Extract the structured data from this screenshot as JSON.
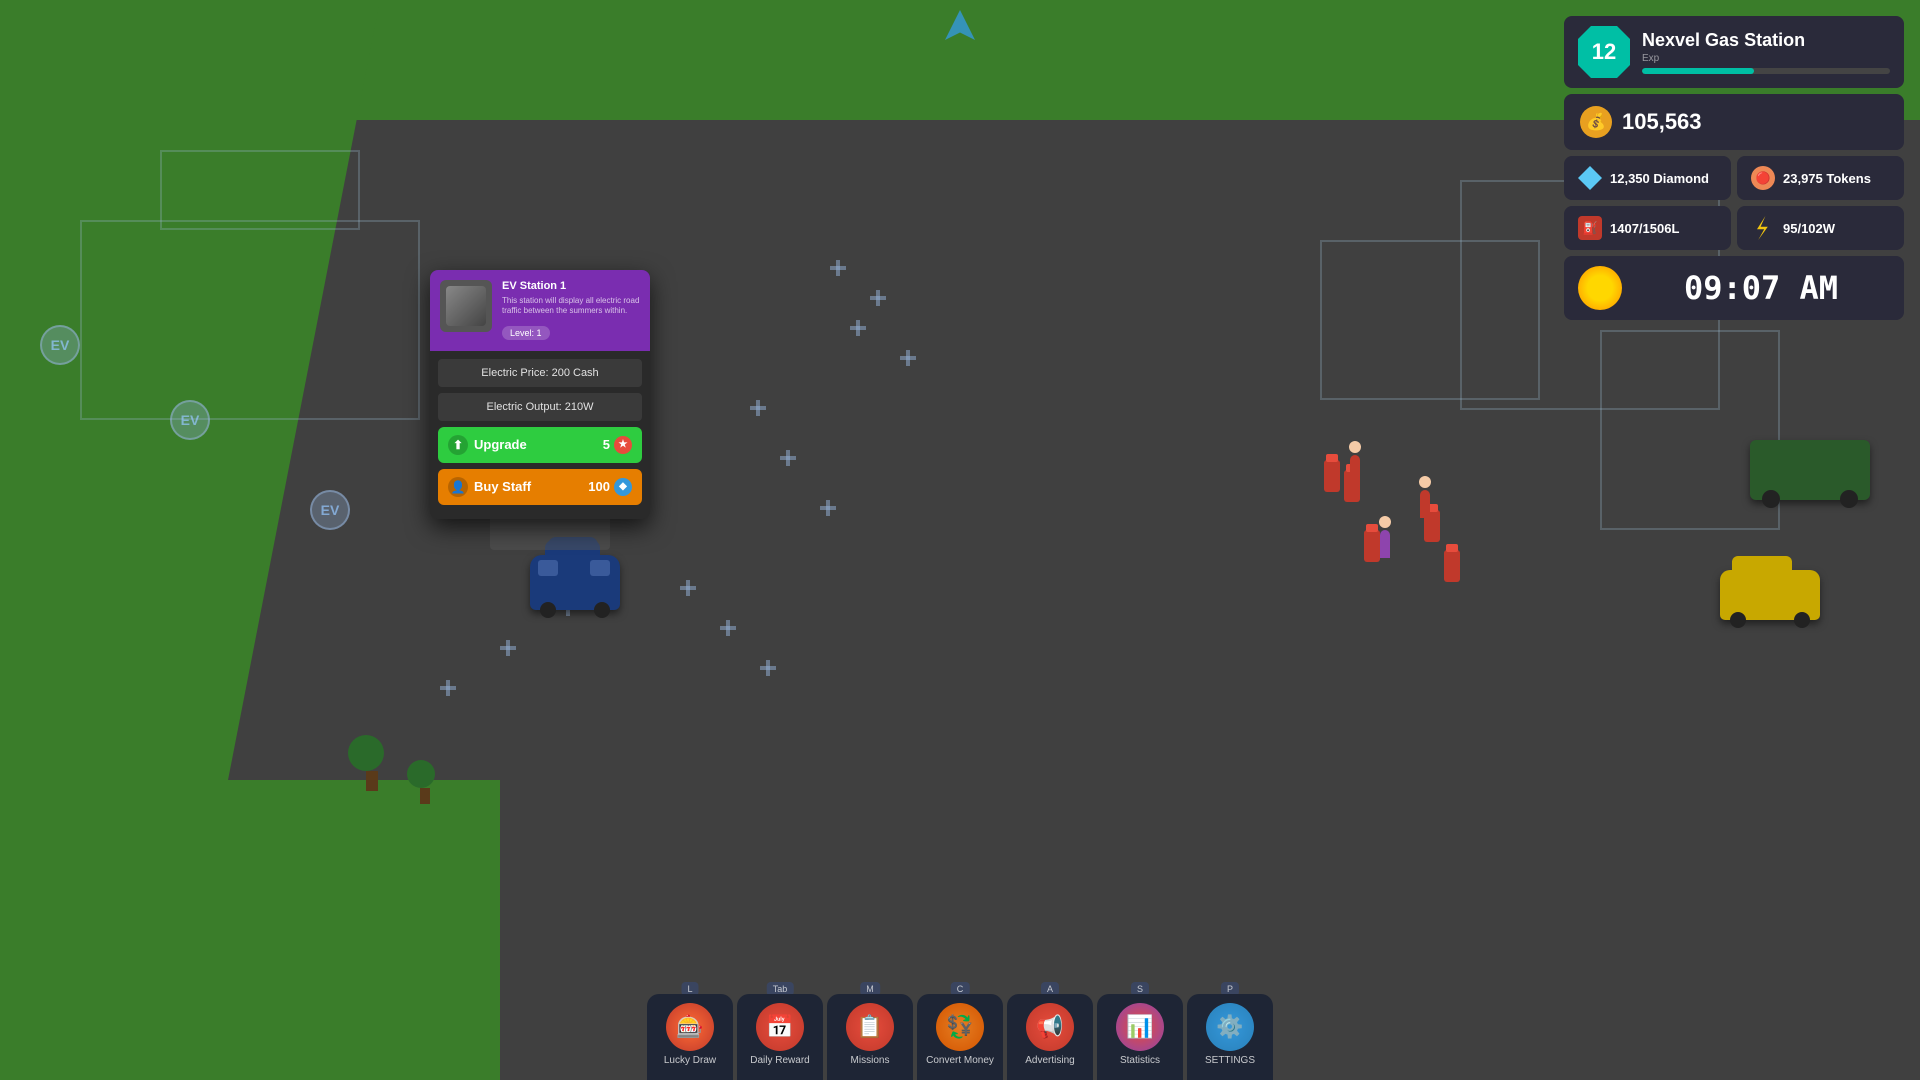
{
  "game": {
    "title": "Nexvel Gas Station"
  },
  "hud": {
    "level": "12",
    "station_name": "Nexvel Gas Station",
    "exp_label": "Exp",
    "exp_percent": 45,
    "cash": "105,563",
    "diamond": "12,350 Diamond",
    "tokens": "23,975 Tokens",
    "fuel": "1407/1506L",
    "power": "95/102W",
    "time": "09:07 AM"
  },
  "popup": {
    "title": "EV Station 1",
    "description": "This station will display all electric road traffic between the summers within.",
    "level": "Level: 1",
    "electric_price": "Electric Price: 200 Cash",
    "electric_output": "Electric Output: 210W",
    "upgrade_label": "Upgrade",
    "upgrade_cost": "5",
    "buy_staff_label": "Buy Staff",
    "buy_staff_cost": "100"
  },
  "toolbar": {
    "items": [
      {
        "id": "lucky-draw",
        "label": "Lucky Draw",
        "key": "L",
        "icon": "🎰"
      },
      {
        "id": "daily-reward",
        "label": "Daily Reward",
        "key": "Tab",
        "icon": "📅"
      },
      {
        "id": "missions",
        "label": "Missions",
        "key": "M",
        "icon": "📋"
      },
      {
        "id": "convert-money",
        "label": "Convert Money",
        "key": "C",
        "icon": "💱"
      },
      {
        "id": "advertising",
        "label": "Advertising",
        "key": "A",
        "icon": "📢"
      },
      {
        "id": "statistics",
        "label": "Statistics",
        "key": "S",
        "icon": "📊"
      },
      {
        "id": "settings",
        "label": "SETTINGS",
        "key": "P",
        "icon": "⚙️"
      }
    ]
  }
}
